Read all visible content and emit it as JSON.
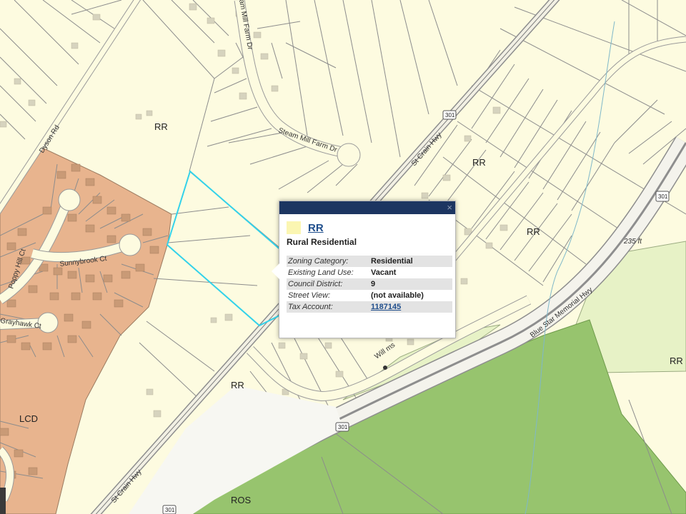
{
  "map": {
    "zone_labels": {
      "rr_1": "RR",
      "rr_2": "RR",
      "rr_3": "RR",
      "rr_4": "RR",
      "rr_5": "RR",
      "lcd": "LCD",
      "ros": "ROS"
    },
    "road_labels": {
      "dyson_rd": "Dyson Rd",
      "steam_mill_farm_dr_upper": "am Mill Farm Dr",
      "steam_mill_farm_dr_lower": "Steam Mill Farm Dr",
      "st_crain_hwy_upper": "St Crain Hwy",
      "st_crain_hwy_lower": "St Crain Hwy",
      "blue_star_memorial_hwy": "Blue Star Memorial Hwy",
      "sunnybrook_ct": "Sunnybrook Ct",
      "poppy_hill_ct": "Poppy Hill Ct",
      "grayhawk_ct": "Grayhawk Ct",
      "williams_rd": "Will ms"
    },
    "shields": {
      "s1": "301",
      "s2": "301",
      "s3": "301",
      "s4": "301"
    },
    "scale_text": "235 ft",
    "colors": {
      "residential": "#fdfbe0",
      "lcd": "#e8b48e",
      "ros": "#97c46e",
      "ros_light": "#e7f2c6",
      "selected_parcel": "#33d2ea",
      "popup_header": "#1c3561"
    }
  },
  "popup": {
    "close_glyph": "×",
    "zone_code": "RR",
    "zone_name": "Rural Residential",
    "rows": [
      {
        "key": "Zoning Category:",
        "value": "Residential"
      },
      {
        "key": "Existing Land Use:",
        "value": "Vacant"
      },
      {
        "key": "Council District:",
        "value": "9"
      },
      {
        "key": "Street View:",
        "value": "(not available)"
      },
      {
        "key": "Tax Account:",
        "value": "1187145"
      }
    ]
  }
}
